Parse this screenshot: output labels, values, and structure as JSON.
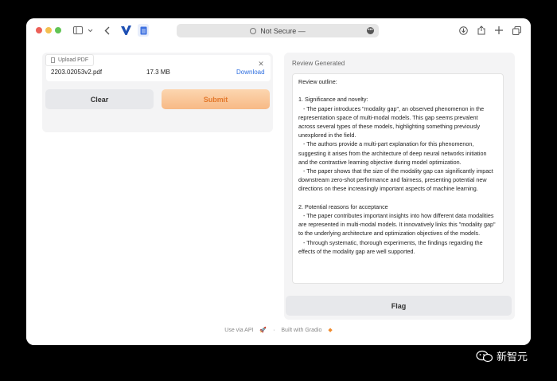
{
  "browser": {
    "address": "Not Secure —",
    "icons": [
      "sidebar-icon",
      "chevron-down-icon",
      "back-icon",
      "v-logo-icon",
      "document-icon",
      "download-icon",
      "share-icon",
      "plus-icon",
      "tabs-icon"
    ]
  },
  "upload": {
    "tag_label": "Upload PDF",
    "file_name": "2203.02053v2.pdf",
    "file_size": "17.3 MB",
    "download_label": "Download"
  },
  "actions": {
    "clear_label": "Clear",
    "submit_label": "Submit",
    "flag_label": "Flag"
  },
  "review": {
    "label": "Review Generated",
    "text": "Review outline:\n\n1. Significance and novelty:\n   - The paper introduces \"modality gap\", an observed phenomenon in the representation space of multi-modal models. This gap seems prevalent across several types of these models, highlighting something previously unexplored in the field.\n   - The authors provide a multi-part explanation for this phenomenon, suggesting it arises from the architecture of deep neural networks initiation and the contrastive learning objective during model optimization.\n   - The paper shows that the size of the modality gap can significantly impact downstream zero-shot performance and fairness, presenting potential new directions on these increasingly important aspects of machine learning.\n\n2. Potential reasons for acceptance\n   - The paper contributes important insights into how different data modalities are represented in multi-modal models. It innovatively links this \"modality gap\" to the underlying architecture and optimization objectives of the models.\n   - Through systematic, thorough experiments, the findings regarding the effects of the modality gap are well supported."
  },
  "footer": {
    "api_label": "Use via API",
    "separator": "·",
    "built_label": "Built with Gradio"
  },
  "watermark": "新智元"
}
